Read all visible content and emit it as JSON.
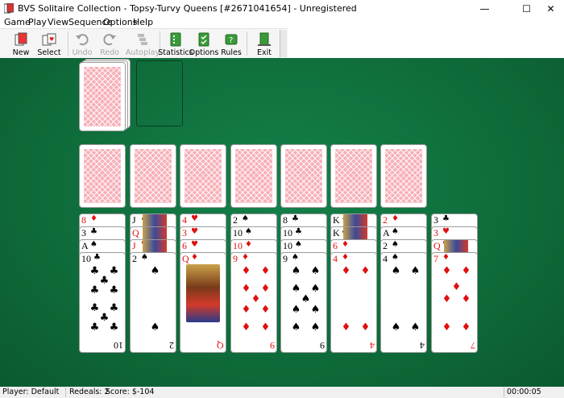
{
  "window": {
    "title": "BVS Solitaire Collection  -  Topsy-Turvy Queens [#2671041654]  -  Unregistered",
    "minimize": "—",
    "maximize": "☐",
    "close": "✕"
  },
  "menu": [
    "Game",
    "Play",
    "View",
    "Sequence",
    "Options",
    "Help"
  ],
  "toolbar": {
    "new": "New",
    "select": "Select",
    "undo": "Undo",
    "redo": "Redo",
    "autoplay": "Autoplay",
    "statistics": "Statistics",
    "options": "Options",
    "rules": "Rules",
    "exit": "Exit"
  },
  "colors": {
    "felt": "#0e6b38",
    "card_back": "#f7b0b8",
    "red_suit": "#e01010"
  },
  "tableau": [
    {
      "cards": [
        {
          "rank": "8",
          "suit": "♦",
          "color": "red"
        },
        {
          "rank": "3",
          "suit": "♣",
          "color": "blk"
        },
        {
          "rank": "A",
          "suit": "♠",
          "color": "blk"
        },
        {
          "rank": "10",
          "suit": "♣",
          "color": "blk",
          "full": true
        }
      ]
    },
    {
      "cards": [
        {
          "rank": "J",
          "suit": "♣",
          "color": "blk"
        },
        {
          "rank": "Q",
          "suit": "♦",
          "color": "red"
        },
        {
          "rank": "J",
          "suit": "♥",
          "color": "red"
        },
        {
          "rank": "2",
          "suit": "♠",
          "color": "blk",
          "full": true
        }
      ]
    },
    {
      "cards": [
        {
          "rank": "4",
          "suit": "♥",
          "color": "red"
        },
        {
          "rank": "3",
          "suit": "♥",
          "color": "red"
        },
        {
          "rank": "6",
          "suit": "♥",
          "color": "red"
        },
        {
          "rank": "Q",
          "suit": "♦",
          "color": "red",
          "full": true
        }
      ]
    },
    {
      "cards": [
        {
          "rank": "2",
          "suit": "♠",
          "color": "blk"
        },
        {
          "rank": "10",
          "suit": "♠",
          "color": "blk"
        },
        {
          "rank": "10",
          "suit": "♦",
          "color": "red"
        },
        {
          "rank": "9",
          "suit": "♦",
          "color": "red",
          "full": true
        }
      ]
    },
    {
      "cards": [
        {
          "rank": "8",
          "suit": "♣",
          "color": "blk"
        },
        {
          "rank": "10",
          "suit": "♣",
          "color": "blk"
        },
        {
          "rank": "10",
          "suit": "♠",
          "color": "blk"
        },
        {
          "rank": "9",
          "suit": "♠",
          "color": "blk",
          "full": true
        }
      ]
    },
    {
      "cards": [
        {
          "rank": "K",
          "suit": "♠",
          "color": "blk"
        },
        {
          "rank": "K",
          "suit": "♣",
          "color": "blk"
        },
        {
          "rank": "6",
          "suit": "♦",
          "color": "red"
        },
        {
          "rank": "4",
          "suit": "♦",
          "color": "red",
          "full": true
        }
      ]
    },
    {
      "cards": [
        {
          "rank": "2",
          "suit": "♦",
          "color": "red"
        },
        {
          "rank": "A",
          "suit": "♠",
          "color": "blk"
        },
        {
          "rank": "2",
          "suit": "♠",
          "color": "blk"
        },
        {
          "rank": "4",
          "suit": "♠",
          "color": "blk",
          "full": true
        }
      ]
    },
    {
      "cards": [
        {
          "rank": "3",
          "suit": "♣",
          "color": "blk"
        },
        {
          "rank": "3",
          "suit": "♥",
          "color": "red"
        },
        {
          "rank": "Q",
          "suit": "♥",
          "color": "red"
        },
        {
          "rank": "7",
          "suit": "♦",
          "color": "red",
          "full": true
        }
      ]
    }
  ],
  "status": {
    "player": "Player: Default",
    "redeals": "Redeals: 2",
    "score": "Score: $-104",
    "time": "00:00:05"
  }
}
